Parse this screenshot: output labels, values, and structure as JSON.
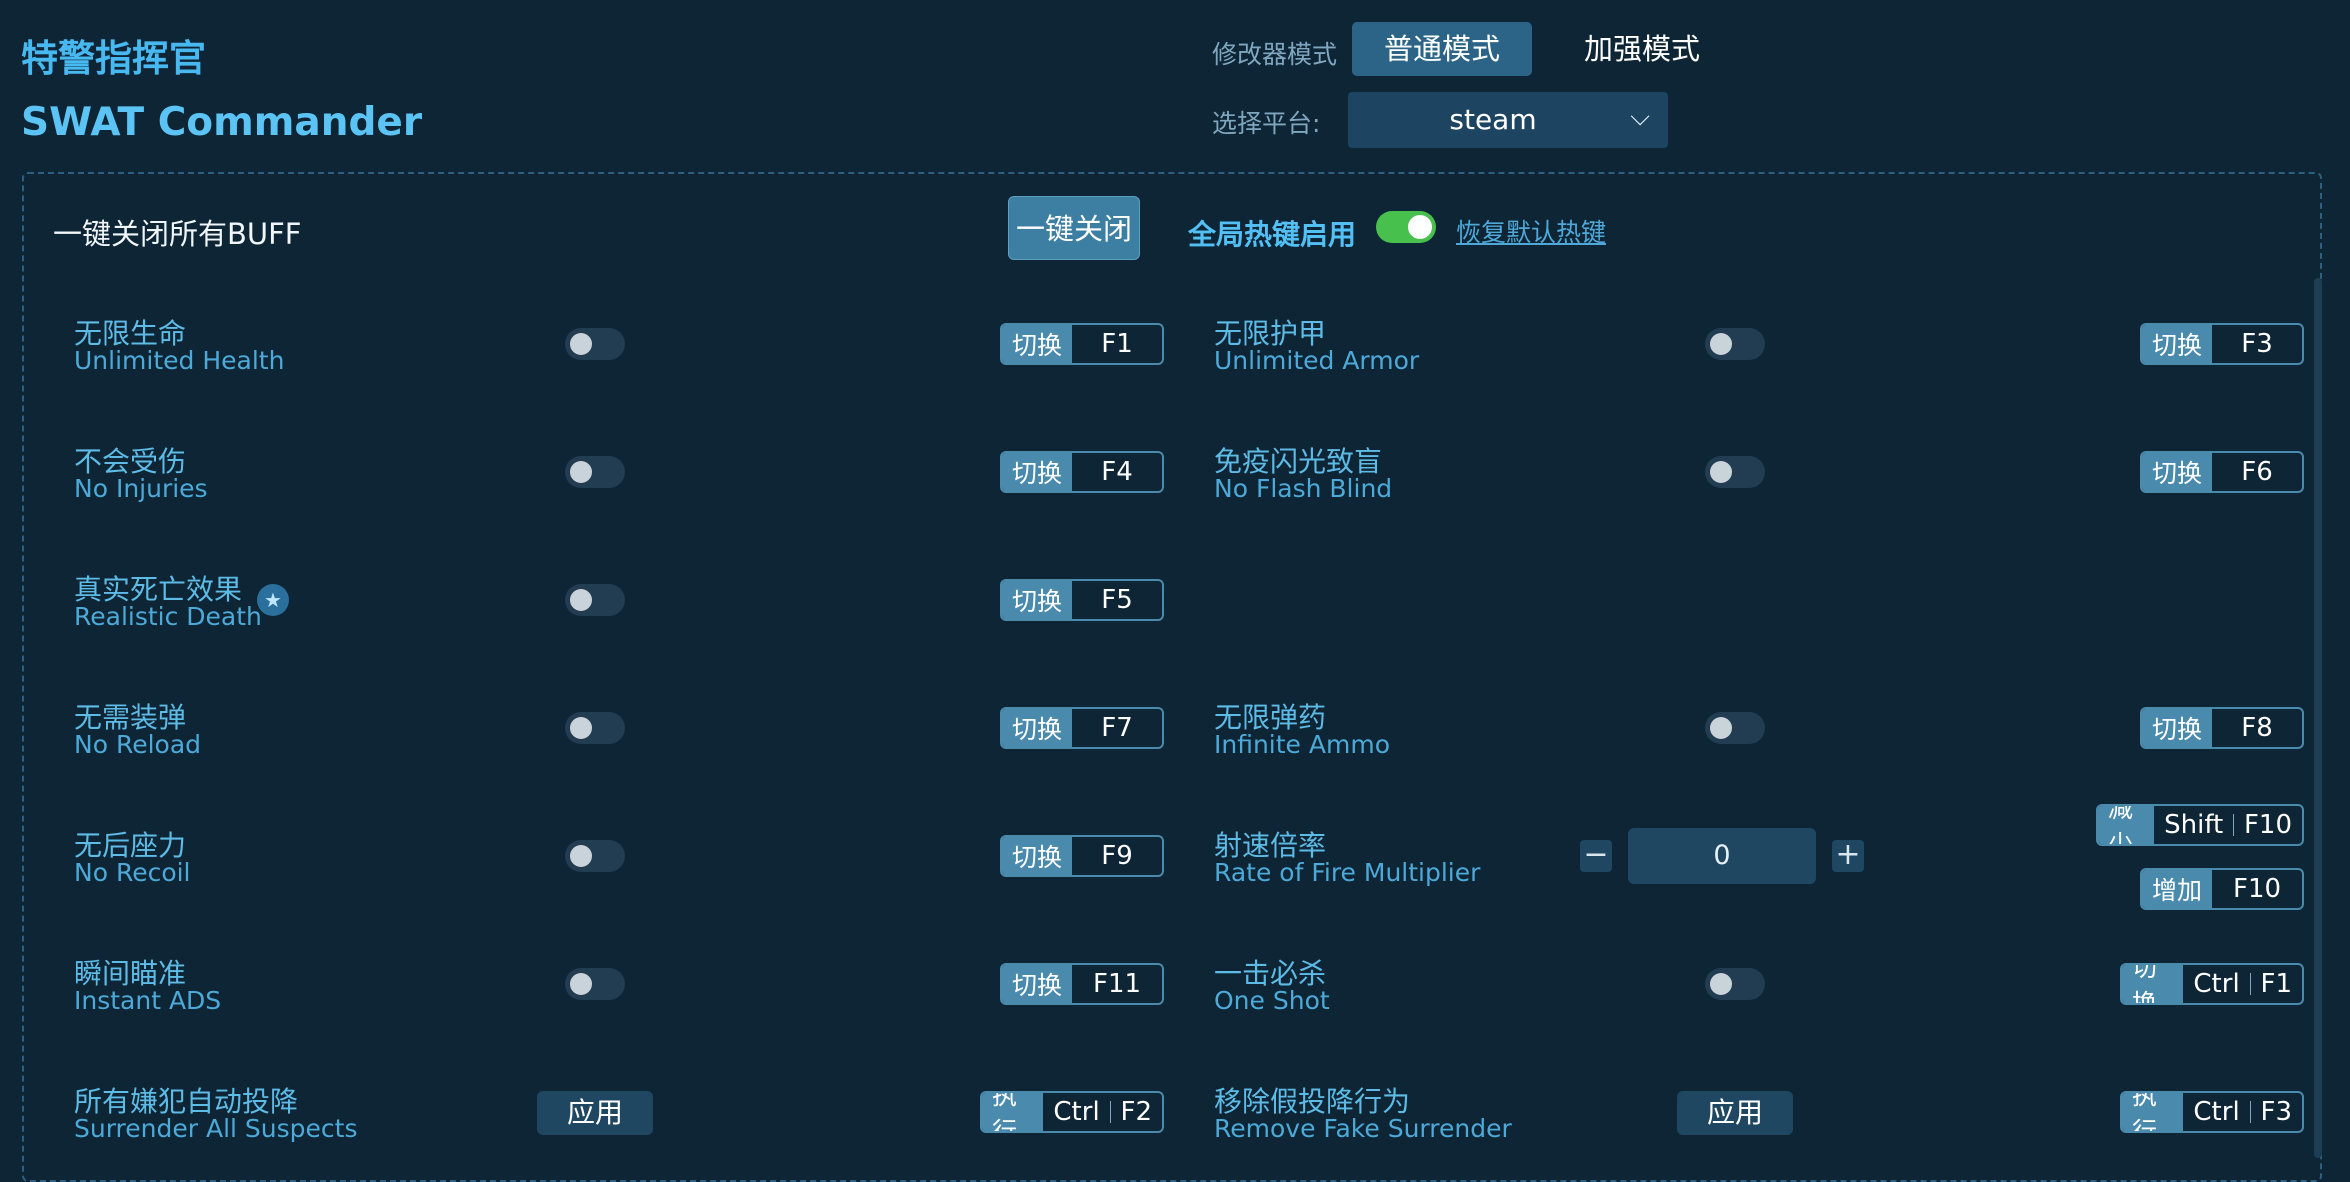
{
  "header": {
    "title_cn": "特警指挥官",
    "title_en": "SWAT Commander"
  },
  "mode": {
    "label": "修改器模式",
    "normal": "普通模式",
    "enhanced": "加强模式"
  },
  "platform": {
    "label": "选择平台:",
    "value": "steam"
  },
  "toolbar": {
    "close_all_label": "一键关闭所有BUFF",
    "close_all_button": "一键关闭",
    "hotkey_label": "全局热键启用",
    "reset_hotkeys": "恢复默认热键"
  },
  "features": [
    {
      "cn": "无限生命",
      "en": "Unlimited Health",
      "action": "切换",
      "keys": [
        "F1"
      ]
    },
    {
      "cn": "无限护甲",
      "en": "Unlimited Armor",
      "action": "切换",
      "keys": [
        "F3"
      ]
    },
    {
      "cn": "不会受伤",
      "en": "No Injuries",
      "action": "切换",
      "keys": [
        "F4"
      ]
    },
    {
      "cn": "免疫闪光致盲",
      "en": "No Flash Blind",
      "action": "切换",
      "keys": [
        "F6"
      ]
    },
    {
      "cn": "真实死亡效果",
      "en": "Realistic Death",
      "action": "切换",
      "keys": [
        "F5"
      ]
    },
    {
      "cn": "无需装弹",
      "en": "No Reload",
      "action": "切换",
      "keys": [
        "F7"
      ]
    },
    {
      "cn": "无限弹药",
      "en": "Infinite Ammo",
      "action": "切换",
      "keys": [
        "F8"
      ]
    },
    {
      "cn": "无后座力",
      "en": "No Recoil",
      "action": "切换",
      "keys": [
        "F9"
      ]
    },
    {
      "cn": "射速倍率",
      "en": "Rate of Fire Multiplier",
      "value": "0",
      "dec_action": "减少",
      "dec_keys": [
        "Shift",
        "F10"
      ],
      "inc_action": "增加",
      "inc_keys": [
        "F10"
      ]
    },
    {
      "cn": "瞬间瞄准",
      "en": "Instant ADS",
      "action": "切换",
      "keys": [
        "F11"
      ]
    },
    {
      "cn": "一击必杀",
      "en": "One Shot",
      "action": "切换",
      "keys": [
        "Ctrl",
        "F1"
      ]
    },
    {
      "cn": "所有嫌犯自动投降",
      "en": "Surrender All Suspects",
      "apply": "应用",
      "action": "执行",
      "keys": [
        "Ctrl",
        "F2"
      ]
    },
    {
      "cn": "移除假投降行为",
      "en": "Remove Fake Surrender",
      "apply": "应用",
      "action": "执行",
      "keys": [
        "Ctrl",
        "F3"
      ]
    }
  ],
  "colors": {
    "background": "#0e2535",
    "accent": "#48b8f0",
    "toggle_on": "#47c04d",
    "key_border": "#4a8aad"
  }
}
